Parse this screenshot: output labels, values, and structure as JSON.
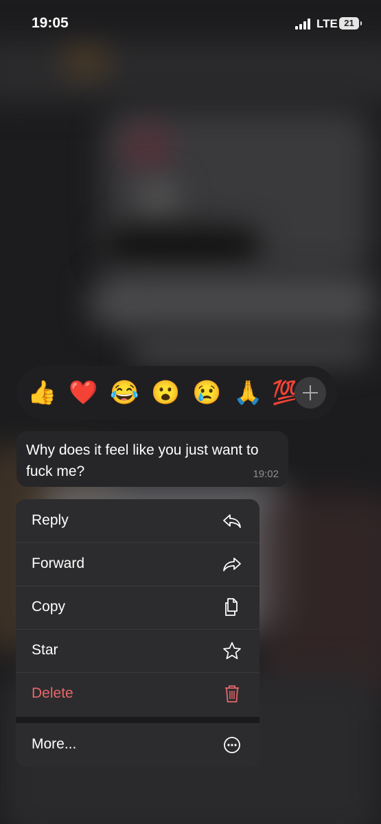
{
  "status_bar": {
    "time": "19:05",
    "network": "LTE",
    "battery": "21"
  },
  "reactions": [
    "👍",
    "❤️",
    "😂",
    "😮",
    "😢",
    "🙏",
    "💯"
  ],
  "message": {
    "text": "Why does it feel like you just want to fuck me?",
    "time": "19:02"
  },
  "menu": {
    "items": [
      {
        "label": "Reply",
        "icon": "reply-icon"
      },
      {
        "label": "Forward",
        "icon": "forward-icon"
      },
      {
        "label": "Copy",
        "icon": "copy-icon"
      },
      {
        "label": "Star",
        "icon": "star-icon"
      },
      {
        "label": "Delete",
        "icon": "trash-icon"
      }
    ],
    "more": {
      "label": "More...",
      "icon": "more-icon"
    }
  },
  "colors": {
    "danger": "#e8676b",
    "menu_bg": "#2c2c2e",
    "bubble_bg": "#262628"
  }
}
